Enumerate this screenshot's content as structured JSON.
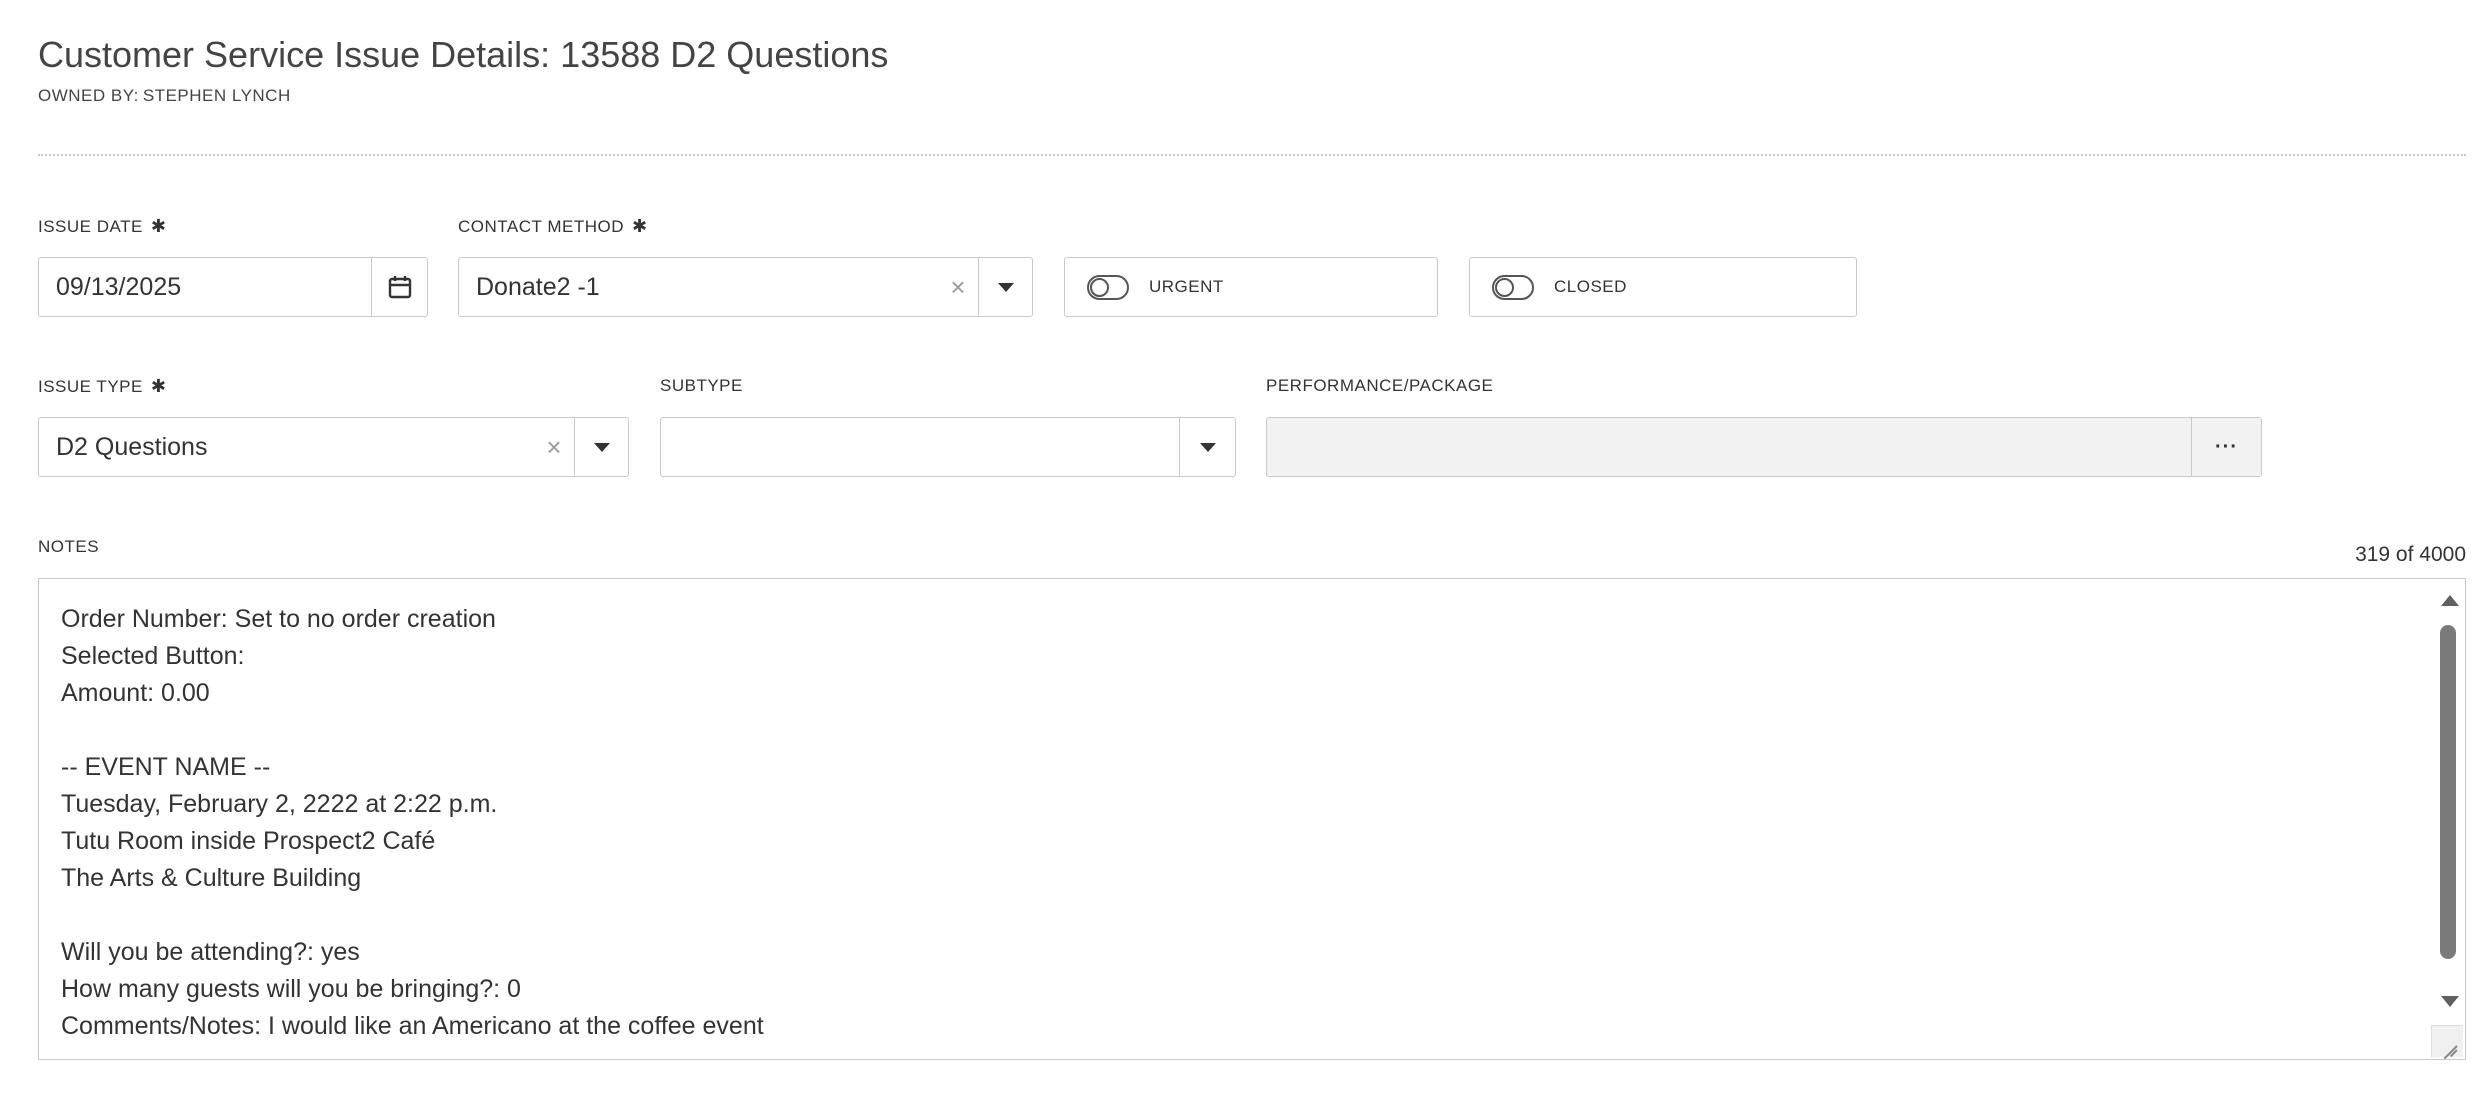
{
  "header": {
    "title": "Customer Service Issue Details: 13588 D2 Questions",
    "owner_prefix": "OWNED BY:",
    "owner_name": "STEPHEN LYNCH"
  },
  "form": {
    "required_marker": "✱",
    "issue_date": {
      "label": "ISSUE DATE",
      "value": "09/13/2025",
      "icon": "calendar-icon"
    },
    "contact_method": {
      "label": "CONTACT METHOD",
      "value": "Donate2 -1",
      "clear_glyph": "×"
    },
    "urgent": {
      "label": "URGENT",
      "on": false
    },
    "closed": {
      "label": "CLOSED",
      "on": false
    },
    "issue_type": {
      "label": "ISSUE TYPE",
      "value": "D2 Questions",
      "clear_glyph": "×"
    },
    "subtype": {
      "label": "SUBTYPE",
      "value": ""
    },
    "performance_package": {
      "label": "PERFORMANCE/PACKAGE",
      "value": "",
      "button_glyph": "···"
    },
    "notes": {
      "label": "NOTES",
      "char_count": "319 of 4000",
      "lines": [
        "Order Number: Set to no order creation",
        "Selected Button:",
        "Amount: 0.00",
        "",
        "-- EVENT NAME --",
        "Tuesday, February 2, 2222 at 2:22 p.m.",
        "Tutu Room inside Prospect2 Café",
        "The Arts & Culture Building",
        "",
        "Will you be attending?: yes",
        "How many guests will you be bringing?: 0",
        "Comments/Notes: I would like an Americano at the coffee event"
      ]
    }
  },
  "colors": {
    "border": "#c9c9c9",
    "text": "#333333",
    "disabled_bg": "#f2f2f2",
    "divider": "#c8c8c8"
  }
}
